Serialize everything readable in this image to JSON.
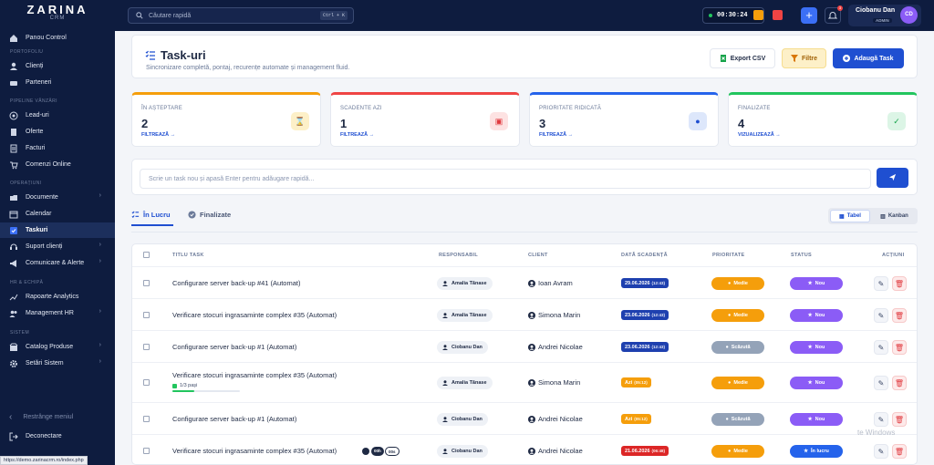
{
  "sidebar": {
    "logo": "ZARINA",
    "logo_sub": "CRM",
    "sections": {
      "portofoliu": "PORTOFOLIU",
      "pipeline": "PIPELINE VÂNZĂRI",
      "operatiuni": "OPERAȚIUNI",
      "hr": "HR & ECHIPĂ",
      "sistem": "SISTEM"
    },
    "items": [
      {
        "label": "Panou Control",
        "icon": "dashboard-icon"
      },
      {
        "label": "Clienți",
        "icon": "user-icon"
      },
      {
        "label": "Parteneri",
        "icon": "handshake-icon"
      },
      {
        "label": "Lead-uri",
        "icon": "target-icon"
      },
      {
        "label": "Oferte",
        "icon": "document-icon"
      },
      {
        "label": "Facturi",
        "icon": "invoice-icon"
      },
      {
        "label": "Comenzi Online",
        "icon": "cart-icon"
      },
      {
        "label": "Documente",
        "icon": "folder-icon"
      },
      {
        "label": "Calendar",
        "icon": "calendar-icon"
      },
      {
        "label": "Taskuri",
        "icon": "checkbox-icon"
      },
      {
        "label": "Suport clienți",
        "icon": "headset-icon"
      },
      {
        "label": "Comunicare & Alerte",
        "icon": "megaphone-icon"
      },
      {
        "label": "Rapoarte Analytics",
        "icon": "chart-icon"
      },
      {
        "label": "Management HR",
        "icon": "users-icon"
      },
      {
        "label": "Catalog Produse",
        "icon": "box-icon"
      },
      {
        "label": "Setări Sistem",
        "icon": "gear-icon"
      }
    ],
    "collapse_label": "Restrânge meniul",
    "logout_label": "Deconectare"
  },
  "topbar": {
    "search_placeholder": "Căutare rapidă",
    "search_shortcut": "Ctrl + K",
    "timer": "00:30:24",
    "bell_count": "3",
    "user_name": "Ciobanu Dan",
    "user_role": "ADMIN",
    "user_initials": "CD"
  },
  "header": {
    "title": "Task-uri",
    "subtitle": "Sincronizare completă, pontaj, recurențe automate și management fluid.",
    "export_label": "Export CSV",
    "filter_label": "Filtre",
    "add_label": "Adaugă Task"
  },
  "stats": [
    {
      "title": "ÎN AȘTEPTARE",
      "value": "2",
      "link": "FILTREAZĂ →",
      "color": "#f59e0b",
      "icon_bg": "#fdf0c8",
      "icon_color": "#b7791f",
      "icon": "hourglass-icon"
    },
    {
      "title": "SCADENTE AZI",
      "value": "1",
      "link": "FILTREAZĂ →",
      "color": "#ef4444",
      "icon_bg": "#fde2e2",
      "icon_color": "#e0393e",
      "icon": "calendar-alert-icon"
    },
    {
      "title": "PRIORITATE RIDICATĂ",
      "value": "3",
      "link": "FILTREAZĂ →",
      "color": "#2563eb",
      "icon_bg": "#dde7fb",
      "icon_color": "#1f4fd1",
      "icon": "fire-icon"
    },
    {
      "title": "FINALIZATE",
      "value": "4",
      "link": "VIZUALIZEAZĂ →",
      "color": "#22c55e",
      "icon_bg": "#dcf5e6",
      "icon_color": "#16a34a",
      "icon": "double-check-icon"
    }
  ],
  "quick_add": {
    "placeholder": "Scrie un task nou și apasă Enter pentru adăugare rapidă..."
  },
  "tabs": {
    "in_progress": "În Lucru",
    "done": "Finalizate"
  },
  "view": {
    "table": "Tabel",
    "kanban": "Kanban"
  },
  "table": {
    "headers": [
      "TITLU TASK",
      "RESPONSABIL",
      "CLIENT",
      "DATĂ SCADENȚĂ",
      "PRIORITATE",
      "STATUS",
      "ACȚIUNI"
    ],
    "rows": [
      {
        "title": "Configurare server back-up #41 (Automat)",
        "owner": "Amalia Tănase",
        "client": "Ioan Avram",
        "date": "29.06.2026",
        "time": "(12:43)",
        "date_color": "#1e40af",
        "priority": "Medie",
        "priority_color": "#f59e0b",
        "status": "Nou",
        "status_color": "#8b5cf6"
      },
      {
        "title": "Verificare stocuri ingrasaminte complex #35 (Automat)",
        "owner": "Amalia Tănase",
        "client": "Simona Marin",
        "date": "23.06.2026",
        "time": "(12:43)",
        "date_color": "#1e40af",
        "priority": "Medie",
        "priority_color": "#f59e0b",
        "status": "Nou",
        "status_color": "#8b5cf6"
      },
      {
        "title": "Configurare server back-up #1 (Automat)",
        "owner": "Ciobanu Dan",
        "client": "Andrei Nicolae",
        "date": "23.06.2026",
        "time": "(12:43)",
        "date_color": "#1e40af",
        "priority": "Scăzută",
        "priority_color": "#94a3b8",
        "status": "Nou",
        "status_color": "#8b5cf6"
      },
      {
        "title": "Verificare stocuri ingrasaminte complex #35 (Automat)",
        "owner": "Amalia Tănase",
        "client": "Simona Marin",
        "date": "Azi",
        "time": "(05:12)",
        "date_color": "#f59e0b",
        "priority": "Medie",
        "priority_color": "#f59e0b",
        "status": "Nou",
        "status_color": "#8b5cf6",
        "progress_label": "1/3 pași",
        "progress": 0.33
      },
      {
        "title": "Configurare server back-up #1 (Automat)",
        "owner": "Ciobanu Dan",
        "client": "Andrei Nicolae",
        "date": "Azi",
        "time": "(05:12)",
        "date_color": "#f59e0b",
        "priority": "Scăzută",
        "priority_color": "#94a3b8",
        "status": "Nou",
        "status_color": "#8b5cf6"
      },
      {
        "title": "Verificare stocuri ingrasaminte complex #35 (Automat)",
        "owner": "Ciobanu Dan",
        "client": "Andrei Nicolae",
        "date": "21.06.2026",
        "time": "(06:48)",
        "date_color": "#dc2626",
        "priority": "Medie",
        "priority_color": "#f59e0b",
        "status": "În lucru",
        "status_color": "#2563eb",
        "timer_a": "00h",
        "timer_b": "00s"
      }
    ]
  },
  "watermark": "te Windows",
  "status_url": "https://demo.zarinacrm.ro/index.php"
}
